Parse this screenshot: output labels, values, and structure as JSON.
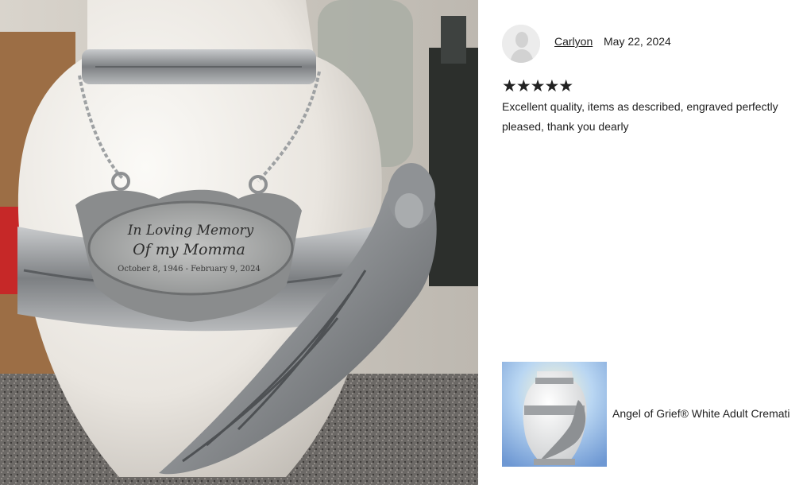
{
  "review": {
    "reviewer_name": "Carlyon",
    "date": "May 22, 2024",
    "rating": 5,
    "stars": "★★★★★",
    "text": "Excellent quality, items as described, engraved perfectly\npleased, thank you dearly"
  },
  "product": {
    "title": "Angel of Grief® White Adult Cremati"
  },
  "photo": {
    "plaque_line1": "In Loving Memory",
    "plaque_line2": "Of my Momma",
    "plaque_line3": "October 8, 1946 - February 9, 2024"
  },
  "colors": {
    "urn_white": "#ece8e2",
    "pewter": "#9a9c9e",
    "countertop": "#6f6c69",
    "text": "#222222"
  }
}
